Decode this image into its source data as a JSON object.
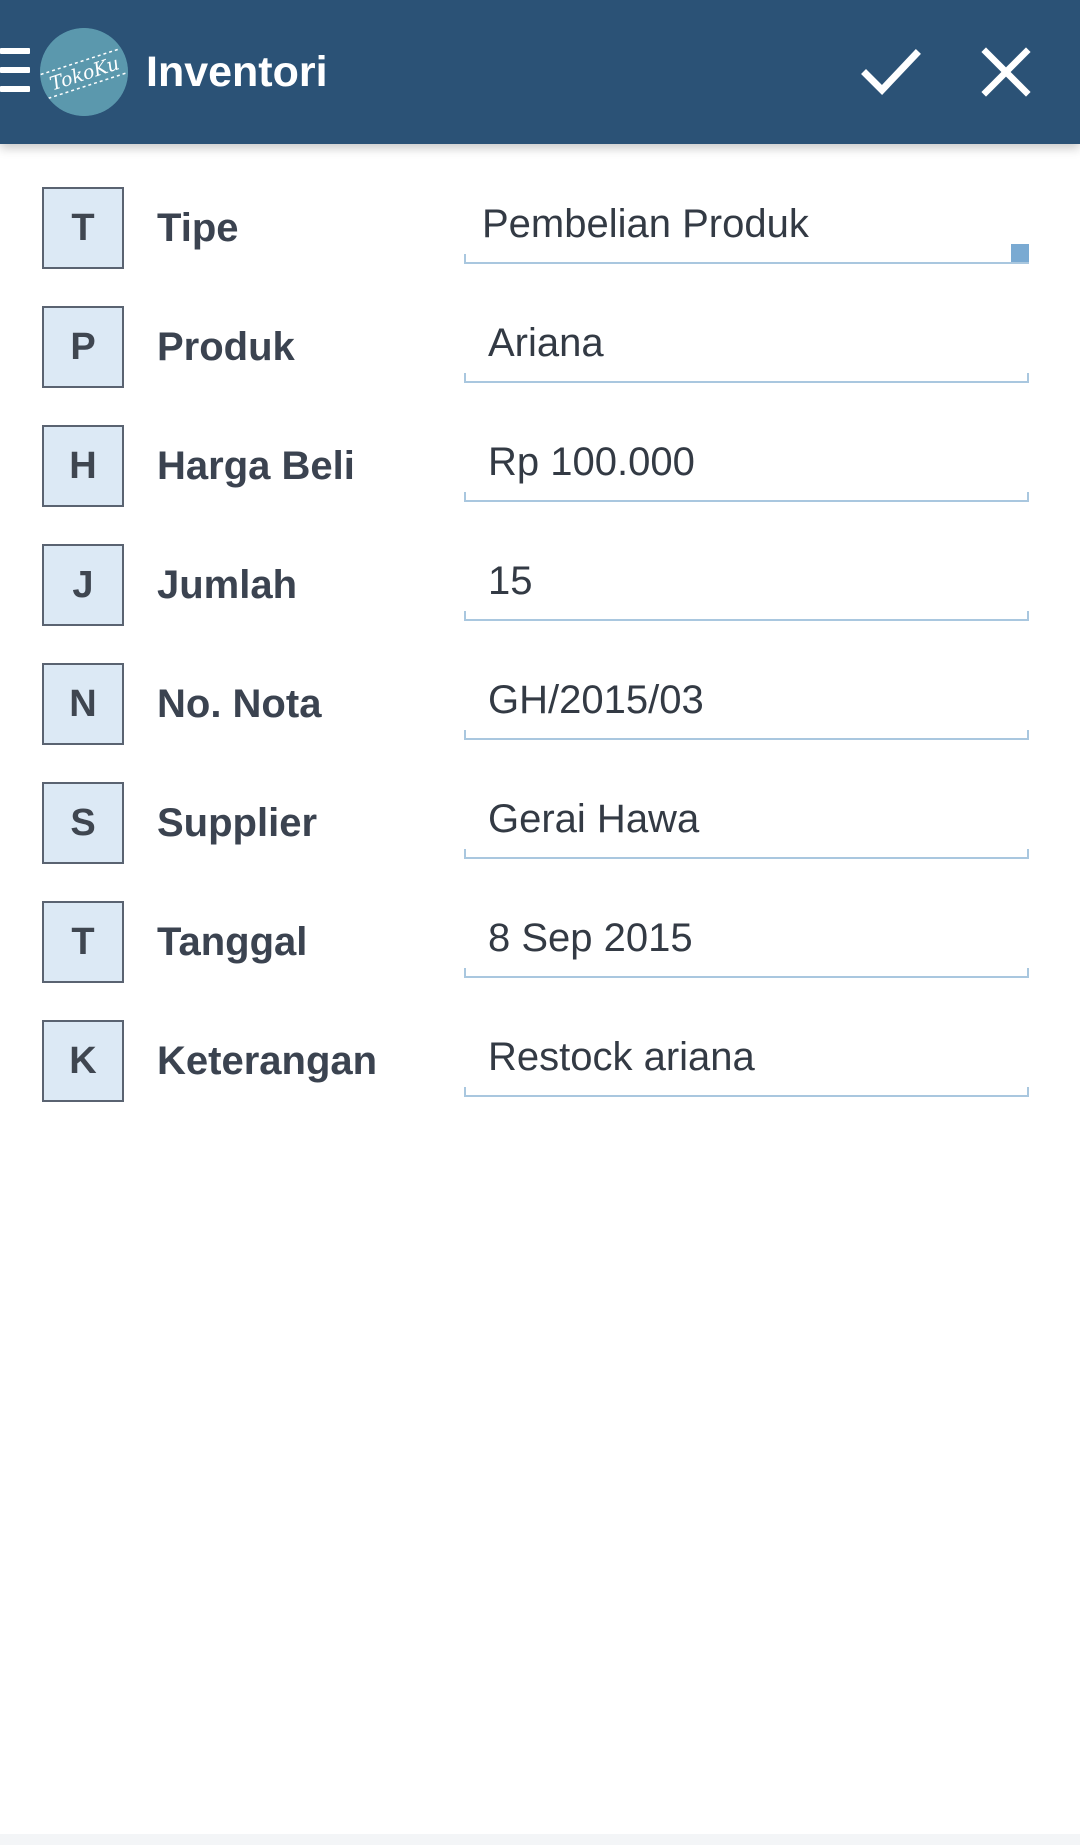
{
  "appbar": {
    "title": "Inventori",
    "logo_text": "TokoKu",
    "menu_icon": "hamburger-menu-icon",
    "confirm_icon": "check-icon",
    "cancel_icon": "close-icon",
    "background_color": "#2b5276"
  },
  "form": {
    "fields": [
      {
        "letter": "T",
        "label": "Tipe",
        "value": "Pembelian Produk",
        "kind": "dropdown"
      },
      {
        "letter": "P",
        "label": "Produk",
        "value": "Ariana",
        "kind": "text"
      },
      {
        "letter": "H",
        "label": "Harga Beli",
        "value": "Rp 100.000",
        "kind": "text"
      },
      {
        "letter": "J",
        "label": "Jumlah",
        "value": "15",
        "kind": "text"
      },
      {
        "letter": "N",
        "label": "No. Nota",
        "value": "GH/2015/03",
        "kind": "text"
      },
      {
        "letter": "S",
        "label": "Supplier",
        "value": "Gerai Hawa",
        "kind": "text"
      },
      {
        "letter": "T",
        "label": "Tanggal",
        "value": "8 Sep 2015",
        "kind": "text"
      },
      {
        "letter": "K",
        "label": "Keterangan",
        "value": "Restock ariana",
        "kind": "text"
      }
    ]
  },
  "colors": {
    "letter_box_fill": "#dce9f5",
    "input_underline": "#a9c7df",
    "dropdown_indicator": "#7aaad2"
  }
}
